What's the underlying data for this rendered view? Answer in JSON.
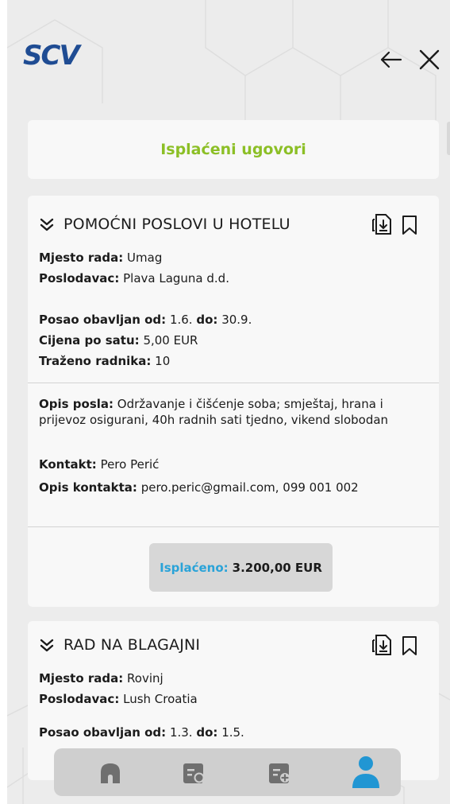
{
  "app": {
    "logo_text": "SCV"
  },
  "header": {
    "back_icon": "arrow-left-icon",
    "close_icon": "close-icon"
  },
  "page": {
    "title": "Isplaćeni ugovori"
  },
  "colors": {
    "accent_green": "#8cbf26",
    "paid_blue": "#2aa3d8",
    "profile_active": "#2196d3",
    "logo_blue": "#1f4c93"
  },
  "jobs": [
    {
      "title": "POMOĆNI POSLOVI U HOTELU",
      "location_label": "Mjesto rada:",
      "location": "Umag",
      "employer_label": "Poslodavac:",
      "employer": "Plava Laguna d.d.",
      "period_label": "Posao obavljan od:",
      "period_from": "1.6.",
      "period_to_label": "do:",
      "period_to": "30.9.",
      "rate_label": "Cijena po satu:",
      "rate": "5,00 EUR",
      "workers_label": "Traženo radnika:",
      "workers": "10",
      "description_label": "Opis posla:",
      "description": "Održavanje i čišćenje soba; smještaj, hrana i prijevoz osigurani, 40h radnih sati tjedno, vikend slobodan",
      "contact_label": "Kontakt:",
      "contact": "Pero Perić",
      "contact_desc_label": "Opis kontakta:",
      "contact_desc": "pero.peric@gmail.com, 099 001 002",
      "paid_label": "Isplaćeno:",
      "paid_value": "3.200,00 EUR"
    },
    {
      "title": "RAD NA BLAGAJNI",
      "location_label": "Mjesto rada:",
      "location": "Rovinj",
      "employer_label": "Poslodavac:",
      "employer": "Lush Croatia",
      "period_label": "Posao obavljan od:",
      "period_from": "1.3.",
      "period_to_label": "do:",
      "period_to": "1.5."
    }
  ],
  "nav": {
    "items": [
      {
        "icon": "home-icon"
      },
      {
        "icon": "search-contracts-icon"
      },
      {
        "icon": "add-contract-icon"
      },
      {
        "icon": "profile-icon",
        "active": true
      }
    ]
  }
}
